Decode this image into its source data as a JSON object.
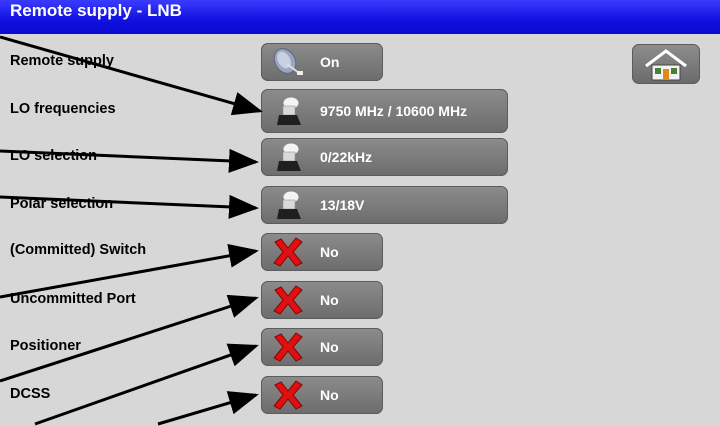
{
  "title": "Remote supply - LNB",
  "rows": [
    {
      "label": "Remote supply",
      "value": "On",
      "icon": "satellite-dish-icon"
    },
    {
      "label": "LO frequencies",
      "value": "9750 MHz / 10600 MHz",
      "icon": "lnb-icon"
    },
    {
      "label": "LO selection",
      "value": "0/22kHz",
      "icon": "lnb-icon"
    },
    {
      "label": "Polar selection",
      "value": "13/18V",
      "icon": "lnb-icon"
    },
    {
      "label": "(Committed) Switch",
      "value": "No",
      "icon": "red-x-icon"
    },
    {
      "label": "Uncommitted Port",
      "value": "No",
      "icon": "red-x-icon"
    },
    {
      "label": "Positioner",
      "value": "No",
      "icon": "red-x-icon"
    },
    {
      "label": "DCSS",
      "value": "No",
      "icon": "red-x-icon"
    }
  ],
  "colors": {
    "titlebar": "#1a1aff",
    "button": "#7c7c7c",
    "background": "#d7d7d7",
    "x_icon": "#e01010"
  }
}
